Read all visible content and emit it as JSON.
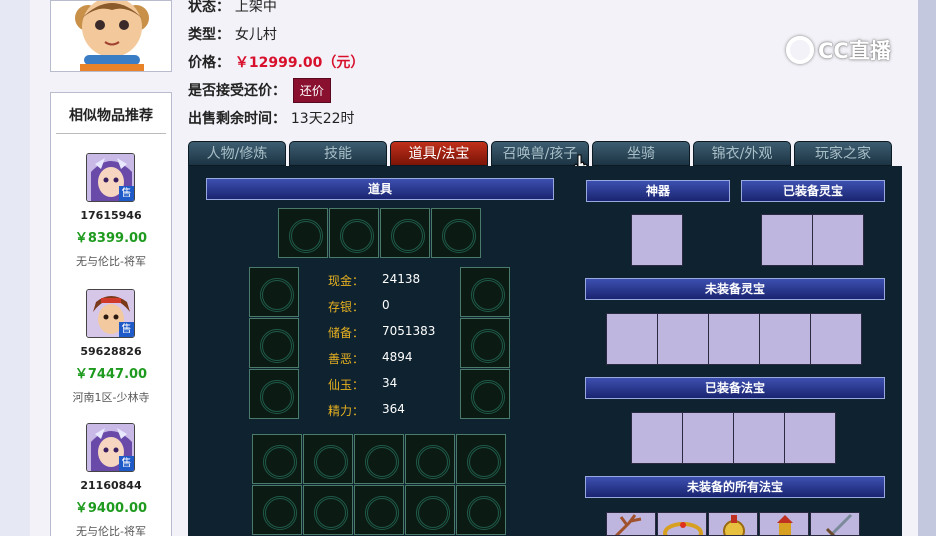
{
  "detail": {
    "status_label": "状态：",
    "status_value": "上架中",
    "type_label": "类型：",
    "type_value": "女儿村",
    "price_label": "价格：",
    "price_value": "￥12999.00（元）",
    "bargain_label": "是否接受还价：",
    "bargain_button": "还价",
    "remaining_label": "出售剩余时间：",
    "remaining_value": "13天22时"
  },
  "watermark": "CC直播",
  "similar": {
    "title": "相似物品推荐",
    "items": [
      {
        "id": "17615946",
        "price": "￥8399.00",
        "server": "无与伦比-将军",
        "badge": "售"
      },
      {
        "id": "59628826",
        "price": "￥7447.00",
        "server": "河南1区-少林寺",
        "badge": "售"
      },
      {
        "id": "21160844",
        "price": "￥9400.00",
        "server": "无与伦比-将军",
        "badge": "售"
      }
    ]
  },
  "tabs": [
    "人物/修炼",
    "技能",
    "道具/法宝",
    "召唤兽/孩子",
    "坐骑",
    "锦衣/外观",
    "玩家之家"
  ],
  "active_tab": "道具/法宝",
  "items_panel": {
    "header": "道具",
    "stats": [
      {
        "label": "现金：",
        "value": "24138"
      },
      {
        "label": "存银：",
        "value": "0"
      },
      {
        "label": "储备：",
        "value": "7051383"
      },
      {
        "label": "善恶：",
        "value": "4894"
      },
      {
        "label": "仙玉：",
        "value": "34"
      },
      {
        "label": "精力：",
        "value": "364"
      }
    ]
  },
  "right_panel": {
    "artifact_header": "神器",
    "equipped_lingbao_header": "已装备灵宝",
    "unequipped_lingbao_header": "未装备灵宝",
    "equipped_fabao_header": "已装备法宝",
    "all_unequipped_fabao_header": "未装备的所有法宝"
  },
  "colors": {
    "active_tab": "#a01e10",
    "tab": "#2a4656",
    "panel": "#0e2230",
    "header_bar": "#24307c",
    "price_red": "#d8102c",
    "price_green": "#1e9a1e",
    "bargain_button": "#8a1030",
    "empty_slot": "#bfb6e0"
  },
  "icons": [
    "cursor-hand-icon",
    "empty-slot-emblem-icon"
  ]
}
